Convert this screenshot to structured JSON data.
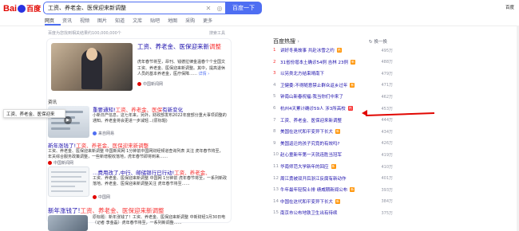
{
  "header": {
    "logo_text_1": "Bai",
    "logo_text_2": "百度",
    "query": "工资、养老金、医保迎来新调整",
    "search_button": "百度一下",
    "top_right": "百度"
  },
  "tabs": [
    {
      "label": "网页",
      "active": true
    },
    {
      "label": "资讯"
    },
    {
      "label": "视频"
    },
    {
      "label": "图片"
    },
    {
      "label": "知道"
    },
    {
      "label": "文库"
    },
    {
      "label": "贴吧"
    },
    {
      "label": "地图"
    },
    {
      "label": "采购"
    },
    {
      "label": "更多"
    }
  ],
  "result_count": "百度为您找到相关结果约100,000,000个",
  "search_tools": "搜索工具",
  "results": {
    "r1": {
      "title_pre": "工资、养老金、医保迎来新",
      "title_em": "调整",
      "desc": "虎年春节将至，昂刊、钱德拉律金温春个个全国文工资、养老金、医保迎来新调整。其中，提高退休人员的基本养老金，医疗保障……",
      "more": "详情 ›",
      "source": "中国新闻网"
    },
    "section_label": "资讯",
    "tooltip": "工资、养老金、医保迎来",
    "r2": {
      "title_pre": "重要通知!",
      "title_em": "工资、养老金、医保",
      "title_post": "有新变化",
      "desc": "小新日产信息，这七年来，另外，财政部发布2022年度部分重大事项调整的通知。养老金将会更进一步减轻...(原标题)",
      "source": "来自网易"
    },
    "r3": {
      "title_pre": "新年涨钱了!",
      "title_em": "工资、养老金、医保迎来新调整",
      "desc": "工资、养老金、医保迎来新调整 中国新闻网 1分钟前中国网财经频道查询列表 关注 虎年春节将至，年关综合服务政策调整，一些新增税收落地，虎年春节即将到来……",
      "source": "中国新闻网"
    },
    "r4": {
      "title_pre": "…费用改了,中行、邮储银行已行动!",
      "title_em": "工资、养老金、",
      "desc": "工资、养老金、医保迎来新调整 中国网 1分钟前 虎年春节将至，一系列新政落地。养老金、医保迎来新调整关注 虎年春节将至……",
      "source": "中国网"
    },
    "r5": {
      "title_pre": "新年涨钱了!",
      "title_em": "工资、养老金、医保迎来新调整",
      "desc": "原标题：新年涨钱了！工资、养老金、医保迎来新调整 中新财经1月30日电（记者 李金磊）虎年春节将至，一系列新调整……"
    }
  },
  "hot": {
    "title": "百度热搜",
    "refresh": "换一换",
    "items": [
      {
        "rank": "1",
        "text": "讲好冬奥故事 共赴冰雪之约",
        "tag": "热",
        "tagcolor": "#ff9406",
        "count": "495万"
      },
      {
        "rank": "2",
        "text": "31省份增本土确诊54例 吉林 23例",
        "tag": "新",
        "tagcolor": "#ff9406",
        "count": "488万"
      },
      {
        "rank": "3",
        "text": "以另类北方结束晴南下",
        "tag": "",
        "tagcolor": "",
        "count": "479万"
      },
      {
        "rank": "4",
        "text": "卫健委:不得随意禁止群众返乡过年",
        "tag": "新",
        "tagcolor": "#ff9406",
        "count": "471万"
      },
      {
        "rank": "5",
        "text": "钟南山新春祝福:我当你们中来了",
        "tag": "",
        "tagcolor": "",
        "count": "462万"
      },
      {
        "rank": "6",
        "text": "杭州4天累计确诊59人 涉3所高校",
        "tag": "热",
        "tagcolor": "#f73131",
        "count": "453万"
      },
      {
        "rank": "7",
        "text": "工资、养老金、医保迎来新调整",
        "tag": "",
        "tagcolor": "",
        "count": "444万"
      },
      {
        "rank": "8",
        "text": "美国在这代和平变异下长大",
        "tag": "新",
        "tagcolor": "#ff9406",
        "count": "434万"
      },
      {
        "rank": "9",
        "text": "美国返迁的孩子究竟的有效吗?",
        "tag": "",
        "tagcolor": "",
        "count": "426万"
      },
      {
        "rank": "10",
        "text": "赵心童新年第一天就连胜当冠军",
        "tag": "",
        "tagcolor": "",
        "count": "419万"
      },
      {
        "rank": "11",
        "text": "华南师范大学新年的回应",
        "tag": "新",
        "tagcolor": "#ff9406",
        "count": "410万"
      },
      {
        "rank": "12",
        "text": "周江勇被双开后浙江反腐有新动作",
        "tag": "",
        "tagcolor": "",
        "count": "401万"
      },
      {
        "rank": "13",
        "text": "牛年最年轻院士排 绩威期新闻公布",
        "tag": "新",
        "tagcolor": "#ff9406",
        "count": "393万"
      },
      {
        "rank": "14",
        "text": "中国在这代和平变异下长大",
        "tag": "新",
        "tagcolor": "#ff9406",
        "count": "384万"
      },
      {
        "rank": "15",
        "text": "南京市公布地铁卫生出有待续",
        "tag": "",
        "tagcolor": "",
        "count": "375万"
      }
    ]
  },
  "colors": {
    "accent": "#4e6ef2",
    "link": "#1a0dab",
    "highlight": "#f73131",
    "annotation_arrow": "#e10601"
  }
}
